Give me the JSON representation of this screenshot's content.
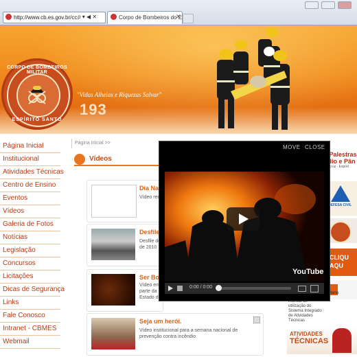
{
  "browser": {
    "url": "http://www.cb.es.gov.br/cc",
    "address_tools": "ρ ▾ ◀ ✕",
    "tab_title": "Corpo de Bombeiros do Es...",
    "tab_close": "✕"
  },
  "header": {
    "logo_top": "CORPO DE BOMBEIROS MILITAR",
    "logo_bottom": "ESPÍRITO SANTO",
    "slogan": "\"Vidas Alheias e Riquezas Salvar\"",
    "emergency_number": "193"
  },
  "nav": {
    "items": [
      "Página Inicial",
      "Institucional",
      "Atividades Técnicas",
      "Centro de Ensino",
      "Eventos",
      "Vídeos",
      "Galeria de Fotos",
      "Notícias",
      "Legislação",
      "Concursos",
      "Licitações",
      "Dicas de Segurança",
      "Links",
      "Fale Conosco",
      "Intranet - CBMES",
      "Webmail"
    ]
  },
  "main": {
    "breadcrumb": "Página Inicial >>",
    "section_title": "Vídeos",
    "videos": [
      {
        "title": "Dia Nac",
        "desc": "Vídeo red"
      },
      {
        "title": "Desfile",
        "desc": "Desfile do\nde 2010"
      },
      {
        "title": "Ser Bom",
        "desc": "Vídeo em\nparte da\nEstado do"
      },
      {
        "title": "Seja um herói.",
        "desc": "Vídeo institucional para a semana nacional de prevenção contra incêndio"
      }
    ]
  },
  "right": {
    "palestra_1": "e Palestras",
    "palestra_2": "ndio e Pân",
    "palestra_3": "Aracruz - Espírit",
    "defesa_civil": "DEFESA CIVIL",
    "clique_1": "CLIQU",
    "clique_2": "AQU",
    "manual_text": "Manual de utilização do Sistema Integrado de Atividades Técnicas",
    "manual_label": "Manu",
    "atividades_1": "ATIVIDADES",
    "atividades_2": "TÉCNICAS"
  },
  "player": {
    "move_label": "MOVE",
    "close_label": "CLOSE",
    "time": "0:00 / 0:00",
    "brand": "YouTube"
  },
  "colors": {
    "accent": "#e8761e",
    "nav_text": "#b83a12",
    "video_title": "#d4661a"
  }
}
